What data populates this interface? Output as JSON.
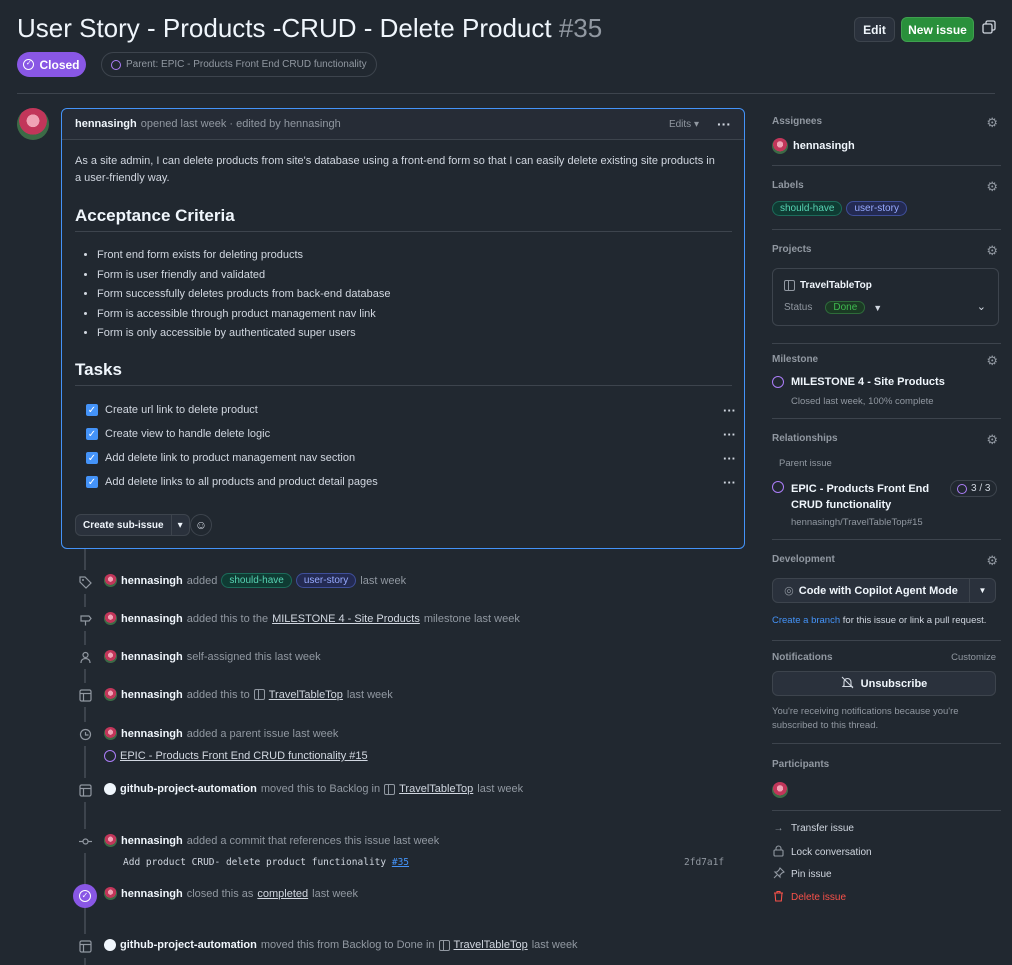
{
  "issue": {
    "title": "User Story - Products -CRUD - Delete Product",
    "number": "#35",
    "state": "Closed",
    "parent_pill": "Parent: EPIC - Products Front End CRUD functionality"
  },
  "header_buttons": {
    "edit": "Edit",
    "new_issue": "New issue"
  },
  "comment": {
    "author": "hennasingh",
    "meta": "opened last week · edited by hennasingh",
    "edits": "Edits",
    "body_line1": "As a site admin, I can delete products from site's database using a front-end form so that I can easily delete existing site products in",
    "body_line2": "a user-friendly way.",
    "h_acceptance": "Acceptance Criteria",
    "criteria": [
      "Front end form exists for deleting products",
      "Form is user friendly and validated",
      "Form successfully deletes products from back-end database",
      "Form is accessible through product management nav link",
      "Form is only accessible by authenticated super users"
    ],
    "h_tasks": "Tasks",
    "tasks": [
      "Create url link to delete product",
      "Create view to handle delete logic",
      "Add delete link to product management nav section",
      "Add delete links to all products and product detail pages"
    ],
    "create_sub_issue": "Create sub-issue"
  },
  "timeline": {
    "e1": {
      "user": "hennasingh",
      "action": "added",
      "label1": "should-have",
      "label2": "user-story",
      "time": "last week"
    },
    "e2": {
      "user": "hennasingh",
      "action": "added this to the",
      "link": "MILESTONE 4 - Site Products",
      "suffix": "milestone last week"
    },
    "e3": {
      "user": "hennasingh",
      "action": "self-assigned this last week"
    },
    "e4": {
      "user": "hennasingh",
      "action": "added this to",
      "link": "TravelTableTop",
      "suffix": "last week"
    },
    "e5": {
      "user": "hennasingh",
      "action": "added a parent issue last week",
      "link": "EPIC - Products Front End CRUD functionality #15"
    },
    "e6": {
      "user": "github-project-automation",
      "action": "moved this to Backlog in",
      "link": "TravelTableTop",
      "suffix": "last week"
    },
    "e7": {
      "user": "hennasingh",
      "action": "added a commit that references this issue last week",
      "commit_msg": "Add product CRUD- delete product functionality",
      "commit_ref": "#35",
      "sha": "2fd7a1f"
    },
    "e8": {
      "user": "hennasingh",
      "action": "closed this as",
      "link": "completed",
      "suffix": "last week"
    },
    "e9": {
      "user": "github-project-automation",
      "action": "moved this from Backlog to Done in",
      "link": "TravelTableTop",
      "suffix": "last week"
    }
  },
  "sidebar": {
    "assignees": {
      "heading": "Assignees",
      "user": "hennasingh"
    },
    "labels": {
      "heading": "Labels",
      "items": [
        "should-have",
        "user-story"
      ]
    },
    "projects": {
      "heading": "Projects",
      "name": "TravelTableTop",
      "status_label": "Status",
      "status": "Done"
    },
    "milestone": {
      "heading": "Milestone",
      "name": "MILESTONE 4 - Site Products",
      "meta": "Closed last week, 100% complete"
    },
    "relationships": {
      "heading": "Relationships",
      "parent_label": "Parent issue",
      "parent_line1": "EPIC - Products Front End",
      "parent_line2": "CRUD functionality",
      "parent_ref": "hennasingh/TravelTableTop#15",
      "count": "3 / 3"
    },
    "development": {
      "heading": "Development",
      "copilot": "Code with Copilot Agent Mode",
      "branch_link": "Create a branch",
      "branch_rest": "for this issue or link a pull request."
    },
    "notifications": {
      "heading": "Notifications",
      "customize": "Customize",
      "unsubscribe": "Unsubscribe",
      "note_line1": "You're receiving notifications because you're",
      "note_line2": "subscribed to this thread."
    },
    "participants": {
      "heading": "Participants"
    },
    "actions": {
      "transfer": "Transfer issue",
      "lock": "Lock conversation",
      "pin": "Pin issue",
      "delete": "Delete issue"
    }
  },
  "colors": {
    "accent": "#4493f8",
    "closed": "#8957e5",
    "success": "#29903b",
    "danger": "#f85149"
  }
}
